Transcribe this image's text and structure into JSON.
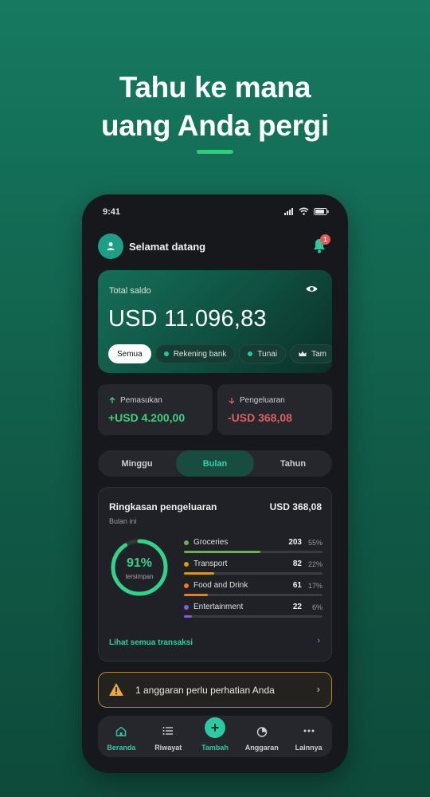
{
  "headline": {
    "line1": "Tahu ke mana",
    "line2": "uang Anda pergi"
  },
  "status_bar": {
    "time": "9:41"
  },
  "header": {
    "greeting": "Selamat datang",
    "notification_count": "1"
  },
  "balance": {
    "label": "Total saldo",
    "value": "USD 11.096,83",
    "chips": [
      {
        "label": "Semua",
        "active": true
      },
      {
        "label": "Rekening bank",
        "active": false
      },
      {
        "label": "Tunai",
        "active": false
      },
      {
        "label": "Tam",
        "active": false
      }
    ]
  },
  "income": {
    "label": "Pemasukan",
    "value": "+USD 4.200,00",
    "color": "#3bd27e"
  },
  "expense": {
    "label": "Pengeluaran",
    "value": "-USD 368,08",
    "color": "#e05d64"
  },
  "period_tabs": [
    {
      "label": "Minggu",
      "active": false
    },
    {
      "label": "Bulan",
      "active": true
    },
    {
      "label": "Tahun",
      "active": false
    }
  ],
  "summary": {
    "title": "Ringkasan pengeluaran",
    "amount": "USD 368,08",
    "subtitle": "Bulan ini",
    "saved_percent_label": "91%",
    "saved_fraction": 0.91,
    "saved_caption": "tersimpan",
    "categories": [
      {
        "name": "Groceries",
        "amount": "203",
        "percent": "55%",
        "fraction": 0.55,
        "color": "#6fb04a"
      },
      {
        "name": "Transport",
        "amount": "82",
        "percent": "22%",
        "fraction": 0.22,
        "color": "#d49a1f"
      },
      {
        "name": "Food and Drink",
        "amount": "61",
        "percent": "17%",
        "fraction": 0.17,
        "color": "#e07e2f"
      },
      {
        "name": "Entertainment",
        "amount": "22",
        "percent": "6%",
        "fraction": 0.06,
        "color": "#8a5ad6"
      }
    ],
    "see_all_label": "Lihat semua transaksi"
  },
  "alert": {
    "text": "1 anggaran perlu perhatian Anda"
  },
  "bottom_nav": [
    {
      "label": "Beranda",
      "icon": "home-icon",
      "active": true
    },
    {
      "label": "Riwayat",
      "icon": "list-icon",
      "active": false
    },
    {
      "label": "Tambah",
      "icon": "plus-icon",
      "active": true
    },
    {
      "label": "Anggaran",
      "icon": "pie-icon",
      "active": false
    },
    {
      "label": "Lainnya",
      "icon": "more-icon",
      "active": false
    }
  ]
}
